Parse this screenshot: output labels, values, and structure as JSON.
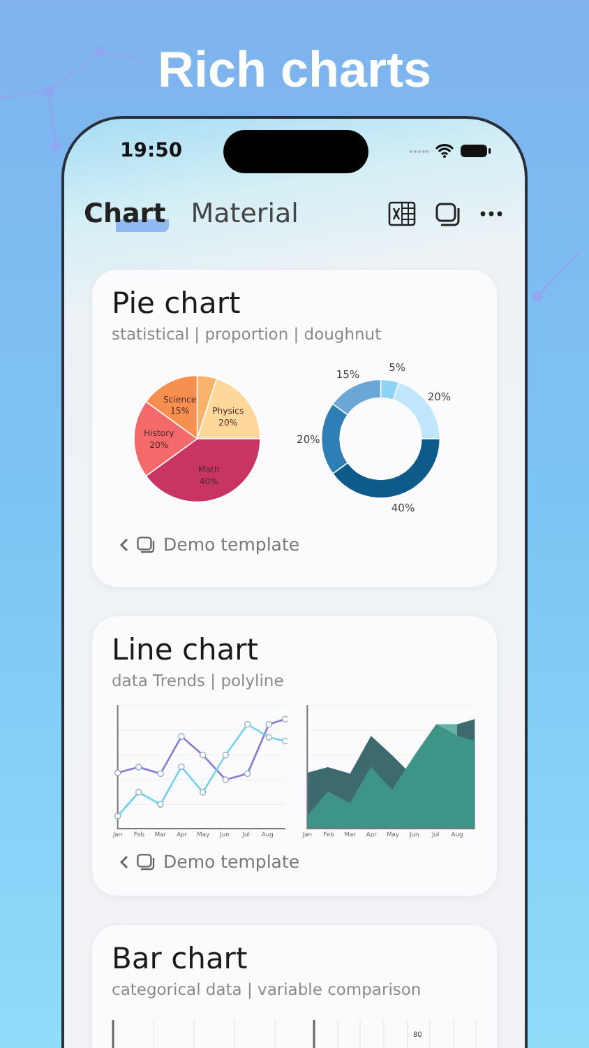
{
  "headline": "Rich charts",
  "status_bar": {
    "time": "19:50"
  },
  "tabs": [
    {
      "label": "Chart",
      "selected": true
    },
    {
      "label": "Material",
      "selected": false
    }
  ],
  "cards": [
    {
      "kind": "pie",
      "title": "Pie chart",
      "subtitle": "statistical | proportion | doughnut",
      "footer": "Demo template",
      "pie": {
        "chart_data": {
          "type": "pie",
          "categories": [
            null,
            "Physics",
            "Math",
            "History",
            "Science"
          ],
          "values": [
            5,
            20,
            40,
            20,
            15
          ],
          "value_labels": [
            null,
            "20%",
            "40%",
            "20%",
            "15%"
          ]
        }
      },
      "donut": {
        "chart_data": {
          "type": "donut",
          "values": [
            5,
            20,
            40,
            20,
            15
          ],
          "value_labels": [
            "5%",
            "20%",
            "40%",
            "20%",
            "15%"
          ]
        }
      }
    },
    {
      "kind": "line",
      "title": "Line chart",
      "subtitle": "data Trends | polyline",
      "footer": "Demo template",
      "line_x_labels": [
        "Jan",
        "Feb",
        "Mar",
        "Apr",
        "May",
        "Jun",
        "Jul",
        "Aug"
      ],
      "area_x_labels": [
        "Jan",
        "Feb",
        "Mar",
        "Apr",
        "May",
        "Jun",
        "Jul",
        "Aug"
      ]
    },
    {
      "kind": "bar",
      "title": "Bar chart",
      "subtitle": "categorical data | variable comparison",
      "value_label": "80"
    }
  ]
}
